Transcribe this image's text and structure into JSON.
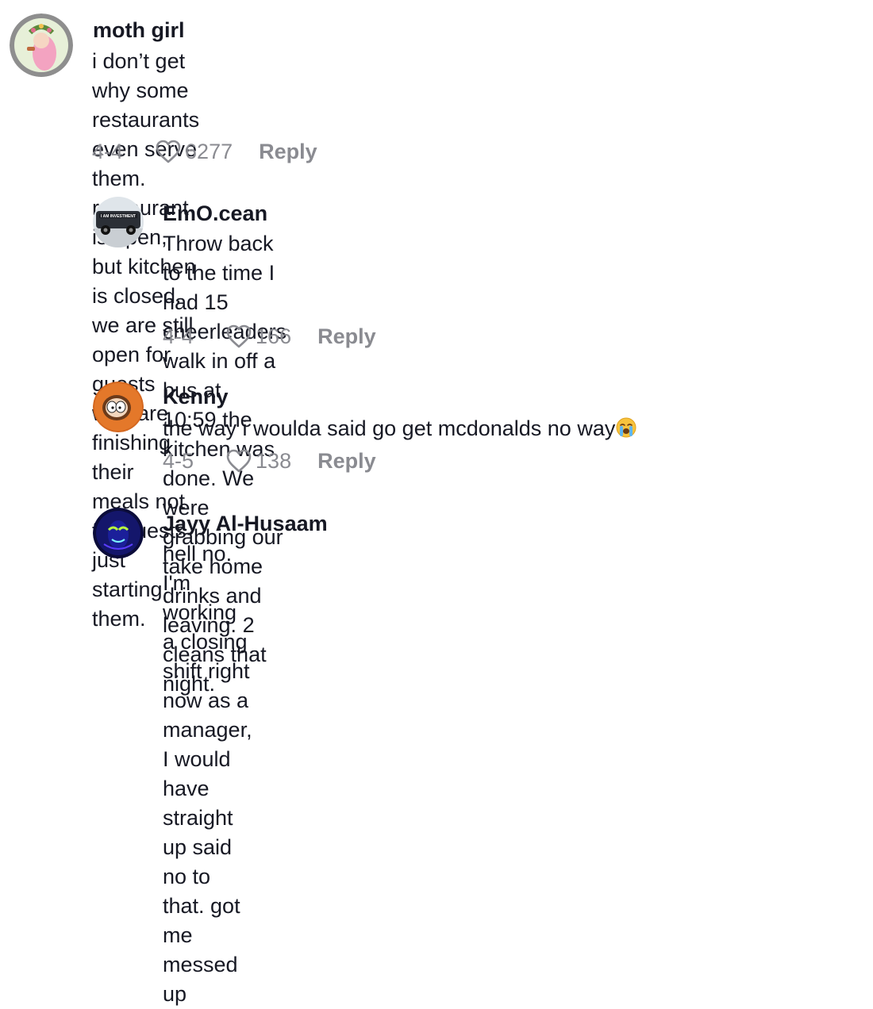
{
  "comments": [
    {
      "username": "moth girl",
      "text": "i don’t get why some restaurants even serve them. restaurant is open,\nbut kitchen is closed. we are still open for guests who are finishing their\nmeals not for guests just starting them.",
      "date": "4-4",
      "likes": "6277",
      "reply_label": "Reply",
      "avatar_icon": "avatar-moth-girl"
    },
    {
      "username": "EmO.cean",
      "text": "Throw back to the time I had 15 cheerleaders walk in off a bus at\n10:59 the kitchen was done. We were grabbing our take home\ndrinks and leaving. 2 cleans that night.",
      "date": "4-4",
      "likes": "166",
      "reply_label": "Reply",
      "avatar_icon": "avatar-truck",
      "avatar_text": "I AM INVESTMENT"
    },
    {
      "username": "Kenny",
      "text": "the way i woulda said go get mcdonalds no way",
      "emoji": "loudly-crying-face-emoji",
      "date": "4-5",
      "likes": "138",
      "reply_label": "Reply",
      "avatar_icon": "avatar-kenny"
    },
    {
      "username": "Jayy Al-Husaam",
      "text": "hell no. I'm working a closing shift right now as a manager, I would\nhave straight up said no to that. got me messed up",
      "avatar_icon": "avatar-neon-mask"
    }
  ],
  "colors": {
    "primary_text": "#161823",
    "secondary_text": "#8a8b91"
  }
}
